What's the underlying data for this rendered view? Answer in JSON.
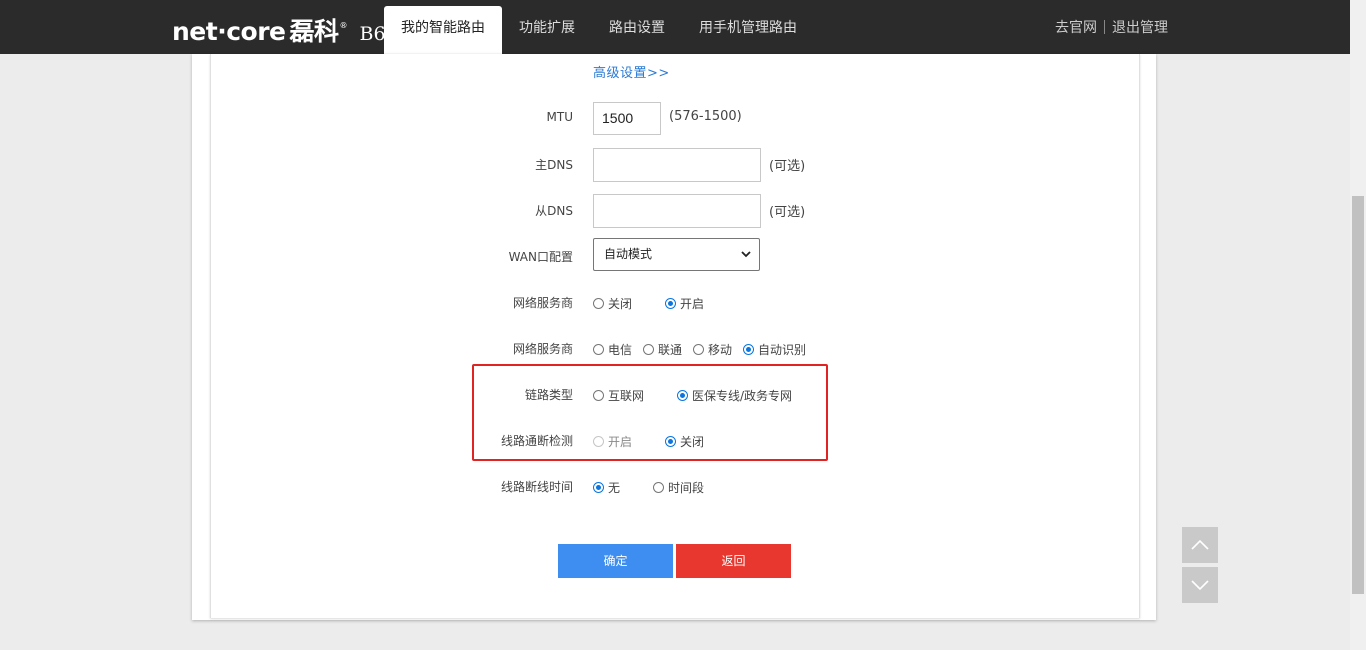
{
  "header": {
    "brand": "net·core",
    "brand_cn": "磊科",
    "reg_mark": "®",
    "model": "B6",
    "tabs": [
      {
        "label": "我的智能路由",
        "active": true
      },
      {
        "label": "功能扩展",
        "active": false
      },
      {
        "label": "路由设置",
        "active": false
      },
      {
        "label": "用手机管理路由",
        "active": false
      }
    ],
    "official_site": "去官网",
    "logout": "退出管理"
  },
  "form": {
    "advanced_link": "高级设置>>",
    "mtu": {
      "label": "MTU",
      "value": "1500",
      "hint": "(576-1500)"
    },
    "primary_dns": {
      "label": "主DNS",
      "value": "",
      "hint": "(可选)"
    },
    "secondary_dns": {
      "label": "从DNS",
      "value": "",
      "hint": "(可选)"
    },
    "wan_config": {
      "label": "WAN口配置",
      "selected": "自动模式"
    },
    "isp_switch": {
      "label": "网络服务商",
      "options": [
        "关闭",
        "开启"
      ],
      "selected": "开启"
    },
    "isp": {
      "label": "网络服务商",
      "options": [
        "电信",
        "联通",
        "移动",
        "自动识别"
      ],
      "selected": "自动识别"
    },
    "link_type": {
      "label": "链路类型",
      "options": [
        "互联网",
        "医保专线/政务专网"
      ],
      "selected": "医保专线/政务专网"
    },
    "link_detect": {
      "label": "线路通断检测",
      "options": [
        "开启",
        "关闭"
      ],
      "selected": "关闭",
      "disabled": [
        "开启"
      ]
    },
    "disconnect_time": {
      "label": "线路断线时间",
      "options": [
        "无",
        "时间段"
      ],
      "selected": "无"
    },
    "buttons": {
      "ok": "确定",
      "back": "返回"
    }
  },
  "colors": {
    "topbar": "#2b2b2b",
    "link": "#2b7bd6",
    "primary_button": "#3d8ef0",
    "danger_button": "#e8372e",
    "highlight_border": "#e02424",
    "radio_checked": "#0a75e0"
  },
  "icons": {
    "scroll_up": "chevron-up-icon",
    "scroll_down": "chevron-down-icon",
    "select_arrow": "chevron-down-icon"
  }
}
